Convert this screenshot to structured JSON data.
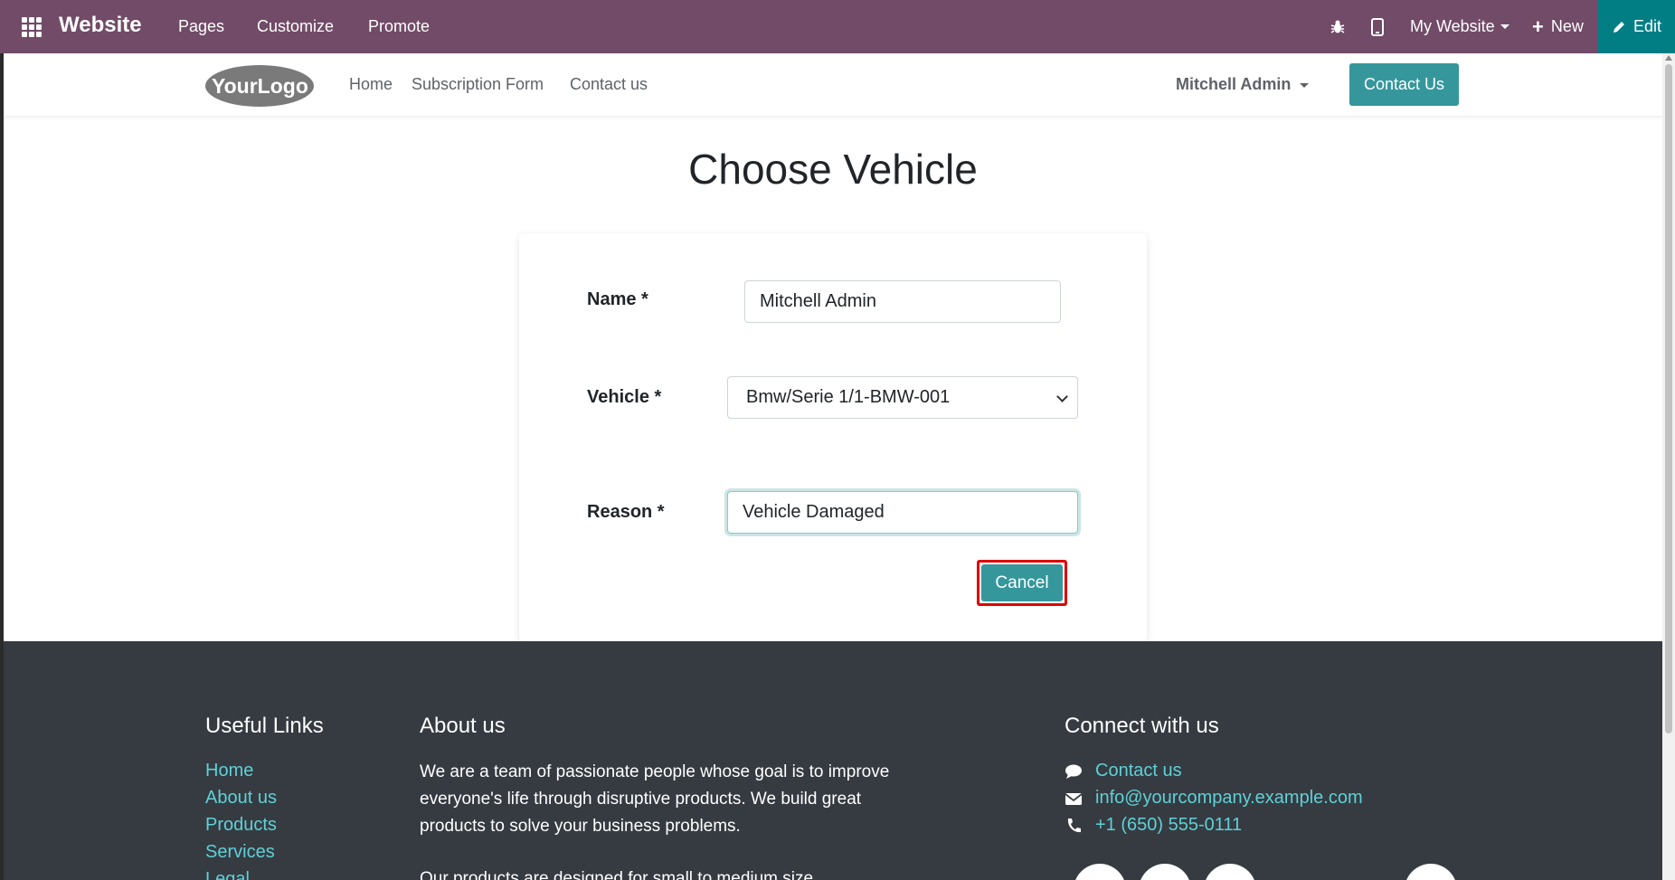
{
  "topbar": {
    "brand": "Website",
    "menu": [
      "Pages",
      "Customize",
      "Promote"
    ],
    "website_selector": "My Website",
    "new_label": "New",
    "edit_label": "Edit"
  },
  "header": {
    "logo_text": "YourLogo",
    "nav": [
      "Home",
      "Subscription Form",
      "Contact us"
    ],
    "user": "Mitchell Admin",
    "contact_button": "Contact Us"
  },
  "page": {
    "title": "Choose Vehicle"
  },
  "form": {
    "name_label": "Name *",
    "name_value": "Mitchell Admin",
    "vehicle_label": "Vehicle *",
    "vehicle_selected": "Bmw/Serie 1/1-BMW-001",
    "reason_label": "Reason *",
    "reason_value": "Vehicle Damaged",
    "cancel_label": "Cancel"
  },
  "footer": {
    "useful_links_heading": "Useful Links",
    "useful_links": [
      "Home",
      "About us",
      "Products",
      "Services",
      "Legal"
    ],
    "about_heading": "About us",
    "about_text": "We are a team of passionate people whose goal is to improve everyone's life through disruptive products. We build great products to solve your business problems.",
    "about_text_2": "Our products are designed for small to medium size",
    "connect_heading": "Connect with us",
    "contact_link": "Contact us",
    "email": "info@yourcompany.example.com",
    "phone": "+1 (650) 555-0111"
  },
  "colors": {
    "topbar": "#714b67",
    "edit": "#017e84",
    "primary": "#35979c",
    "footer": "#363b42",
    "footer_link": "#5ed1d6",
    "highlight": "#e00000"
  }
}
